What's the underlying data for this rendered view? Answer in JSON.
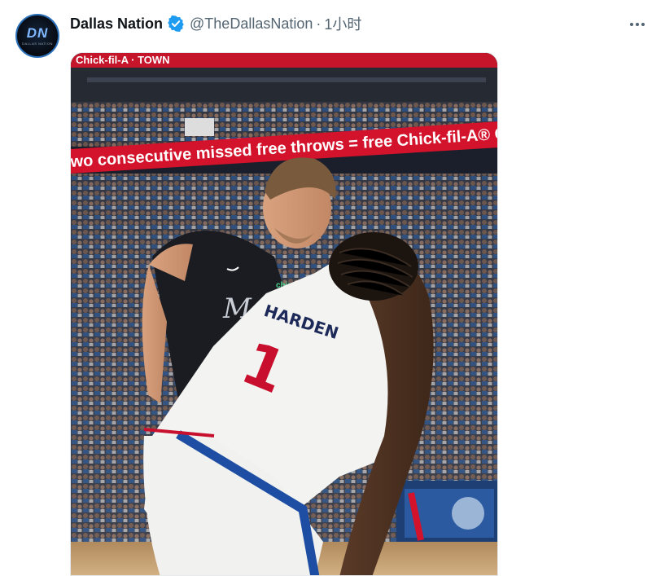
{
  "author": {
    "display_name": "Dallas Nation",
    "handle": "@TheDallasNation",
    "separator": "·",
    "timestamp": "1小时",
    "avatar_text": "DN",
    "avatar_subtext": "DALLAS NATION",
    "verified": true
  },
  "media": {
    "top_banner_text": "Chick-fil-A  ·  TOWN",
    "arena_ribbon_text": "wo consecutive missed free throws = free Chick-fil-A® C",
    "jersey_name": "HARDEN",
    "jersey_number": "1",
    "opponent_jersey_logo": "M",
    "sponsor_patch": "chime"
  },
  "icons": {
    "verified": "verified-badge-icon",
    "more": "more-options-icon"
  },
  "colors": {
    "verified_blue": "#1d9bf0",
    "secondary_text": "#536471",
    "ribbon_red": "#d3122b",
    "jersey_red": "#c8102e",
    "jersey_navy": "#1d2a59"
  }
}
